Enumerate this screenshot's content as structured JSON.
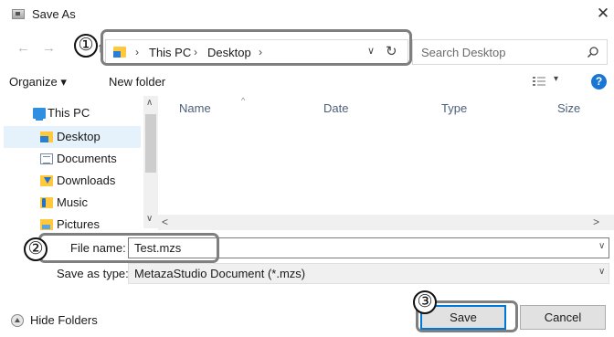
{
  "window": {
    "title": "Save As",
    "close_glyph": "✕"
  },
  "nav": {
    "back_glyph": "←",
    "forward_glyph": "→",
    "up_glyph": "↑",
    "path": [
      "This PC",
      "Desktop"
    ],
    "separator": "›",
    "dropdown_glyph": "∨",
    "refresh_glyph": "↻",
    "search_placeholder": "Search Desktop"
  },
  "toolbar": {
    "organize_label": "Organize ▾",
    "new_folder_label": "New folder",
    "view_caret": "▾",
    "help_glyph": "?"
  },
  "sidebar": {
    "items": [
      {
        "label": "This PC",
        "icon": "pc-icon"
      },
      {
        "label": "Desktop",
        "icon": "desktop-folder-icon",
        "selected": true
      },
      {
        "label": "Documents",
        "icon": "documents-folder-icon"
      },
      {
        "label": "Downloads",
        "icon": "downloads-folder-icon"
      },
      {
        "label": "Music",
        "icon": "music-folder-icon"
      },
      {
        "label": "Pictures",
        "icon": "pictures-folder-icon"
      }
    ],
    "scroll_up": "∧",
    "scroll_down": "∨"
  },
  "file_list": {
    "columns": [
      "Name",
      "Date",
      "Type",
      "Size"
    ],
    "sort_indicator": "^",
    "scroll_left": "<",
    "scroll_right": ">"
  },
  "form": {
    "file_name_label": "File name:",
    "file_name_value": "Test.mzs",
    "save_type_label": "Save as type:",
    "save_type_value": "MetazaStudio Document (*.mzs)",
    "caret": "∨"
  },
  "footer": {
    "hide_folders_label": "Hide Folders",
    "save_label": "Save",
    "cancel_label": "Cancel"
  },
  "callouts": [
    "①",
    "②",
    "③"
  ],
  "colors": {
    "accent": "#0078d7",
    "selected_bg": "#e5f1fb",
    "help": "#1976d2",
    "callout_border": "#7f7f7f"
  }
}
